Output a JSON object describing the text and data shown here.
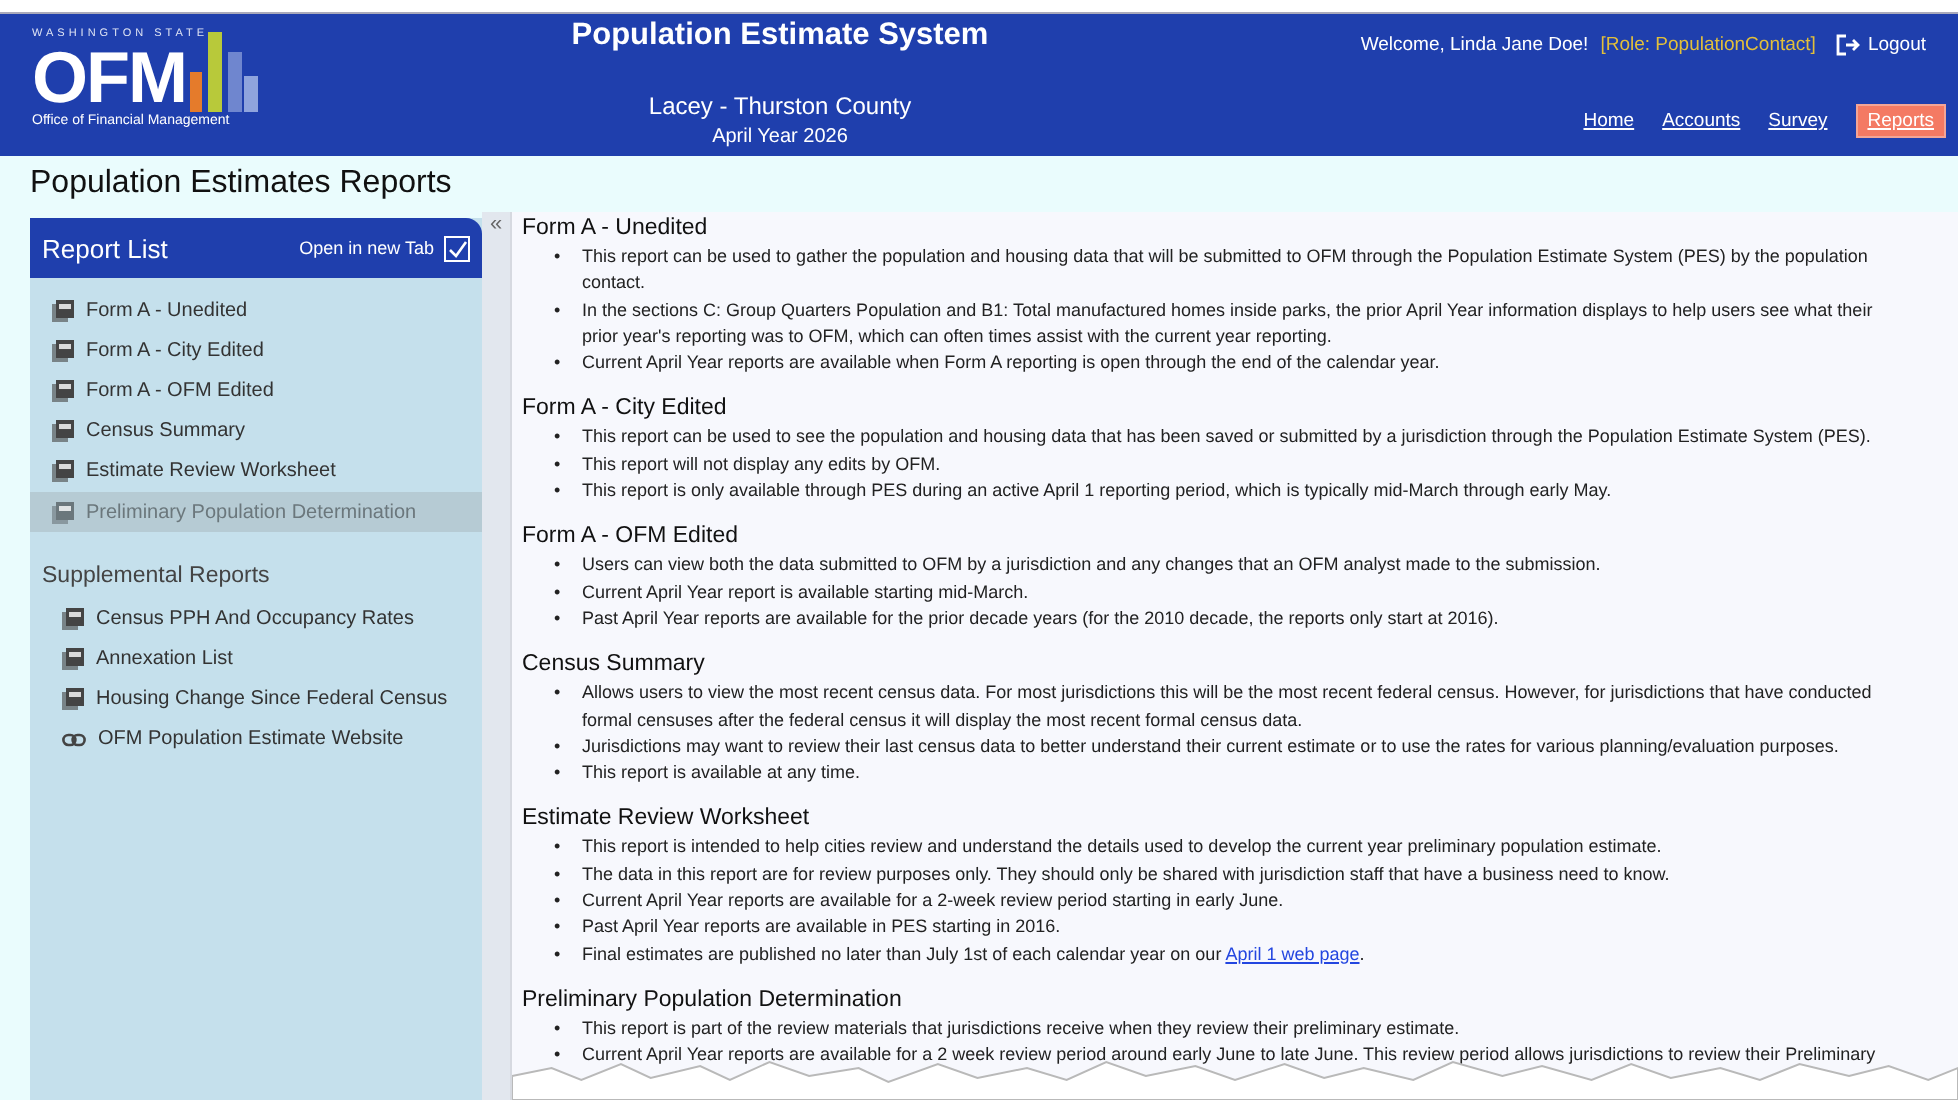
{
  "logo": {
    "state": "WASHINGTON STATE",
    "mark": "OFM",
    "subtitle": "Office of Financial Management"
  },
  "header": {
    "title": "Population Estimate System",
    "location": "Lacey - Thurston County",
    "year": "April Year 2026",
    "welcome": "Welcome, Linda Jane Doe!",
    "role": "[Role: PopulationContact]",
    "logout": "Logout"
  },
  "nav": [
    {
      "label": "Home",
      "selected": false
    },
    {
      "label": "Accounts",
      "selected": false
    },
    {
      "label": "Survey",
      "selected": false
    },
    {
      "label": "Reports",
      "selected": true
    }
  ],
  "page_title": "Population Estimates Reports",
  "sidebar": {
    "title": "Report List",
    "open_new_tab": {
      "label": "Open in new Tab",
      "checked": true
    },
    "collapse": "«",
    "items": [
      {
        "label": "Form A - Unedited",
        "kind": "pdf",
        "disabled": false
      },
      {
        "label": "Form A - City Edited",
        "kind": "pdf",
        "disabled": false
      },
      {
        "label": "Form A - OFM Edited",
        "kind": "pdf",
        "disabled": false
      },
      {
        "label": "Census Summary",
        "kind": "pdf",
        "disabled": false
      },
      {
        "label": "Estimate Review Worksheet",
        "kind": "pdf",
        "disabled": false
      },
      {
        "label": "Preliminary Population Determination",
        "kind": "pdf",
        "disabled": true
      }
    ],
    "supplemental_title": "Supplemental Reports",
    "supplemental": [
      {
        "label": "Census PPH And Occupancy Rates",
        "kind": "pdf",
        "disabled": false
      },
      {
        "label": "Annexation List",
        "kind": "pdf",
        "disabled": false
      },
      {
        "label": "Housing Change Since Federal Census",
        "kind": "pdf",
        "disabled": false
      },
      {
        "label": "OFM Population Estimate Website",
        "kind": "link",
        "disabled": false
      }
    ]
  },
  "bullet_marker": "•",
  "sections": [
    {
      "title": "Form A - Unedited",
      "bullets": [
        {
          "text": "This report can be used to gather the population and housing data that will be submitted to OFM through the Population Estimate System (PES) by the population contact."
        },
        {
          "text": "In the sections C: Group Quarters Population and B1: Total manufactured homes inside parks, the prior April Year information displays to help users see what their prior year's reporting was to OFM, which can often times assist with the current year reporting."
        },
        {
          "text": "Current April Year reports are available when Form A reporting is open through the end of the calendar year."
        }
      ]
    },
    {
      "title": "Form A - City Edited",
      "bullets": [
        {
          "text": "This report can be used to see the population and housing data that has been saved or submitted by a jurisdiction through the Population Estimate System (PES)."
        },
        {
          "text": "This report will not display any edits by OFM."
        },
        {
          "text": "This report is only available through PES during an active April 1 reporting period, which is typically mid-March through early May."
        }
      ]
    },
    {
      "title": "Form A - OFM Edited",
      "bullets": [
        {
          "text": "Users can view both the data submitted to OFM by a jurisdiction and any changes that an OFM analyst made to the submission."
        },
        {
          "text": "Current April Year report is available starting mid-March."
        },
        {
          "text": "Past April Year reports are available for the prior decade years (for the 2010 decade, the reports only start at 2016)."
        }
      ]
    },
    {
      "title": "Census Summary",
      "bullets": [
        {
          "text": "Allows users to view the most recent census data. For most jurisdictions this will be the most recent federal census. However, for jurisdictions that have conducted formal censuses after the federal census it will display the most recent formal census data."
        },
        {
          "text": "Jurisdictions may want to review their last census data to better understand their current estimate or to use the rates for various planning/evaluation purposes."
        },
        {
          "text": "This report is available at any time."
        }
      ]
    },
    {
      "title": "Estimate Review Worksheet",
      "bullets": [
        {
          "text": "This report is intended to help cities review and understand the details used to develop the current year preliminary population estimate."
        },
        {
          "text": "The data in this report are for review purposes only. They should only be shared with jurisdiction staff that have a business need to know."
        },
        {
          "text": "Current April Year reports are available for a 2-week review period starting in early June."
        },
        {
          "text": "Past April Year reports are available in PES starting in 2016."
        },
        {
          "text": "Final estimates are published no later than July 1st of each calendar year on our ",
          "link": "April 1 web page",
          "after": "."
        }
      ]
    },
    {
      "title": "Preliminary Population Determination",
      "bullets": [
        {
          "text": "This report is part of the review materials that jurisdictions receive when they review their preliminary estimate."
        },
        {
          "text": "Current April Year reports are available for a 2 week review period around early June to late June. This review period allows jurisdictions to review their Preliminary"
        }
      ]
    }
  ]
}
